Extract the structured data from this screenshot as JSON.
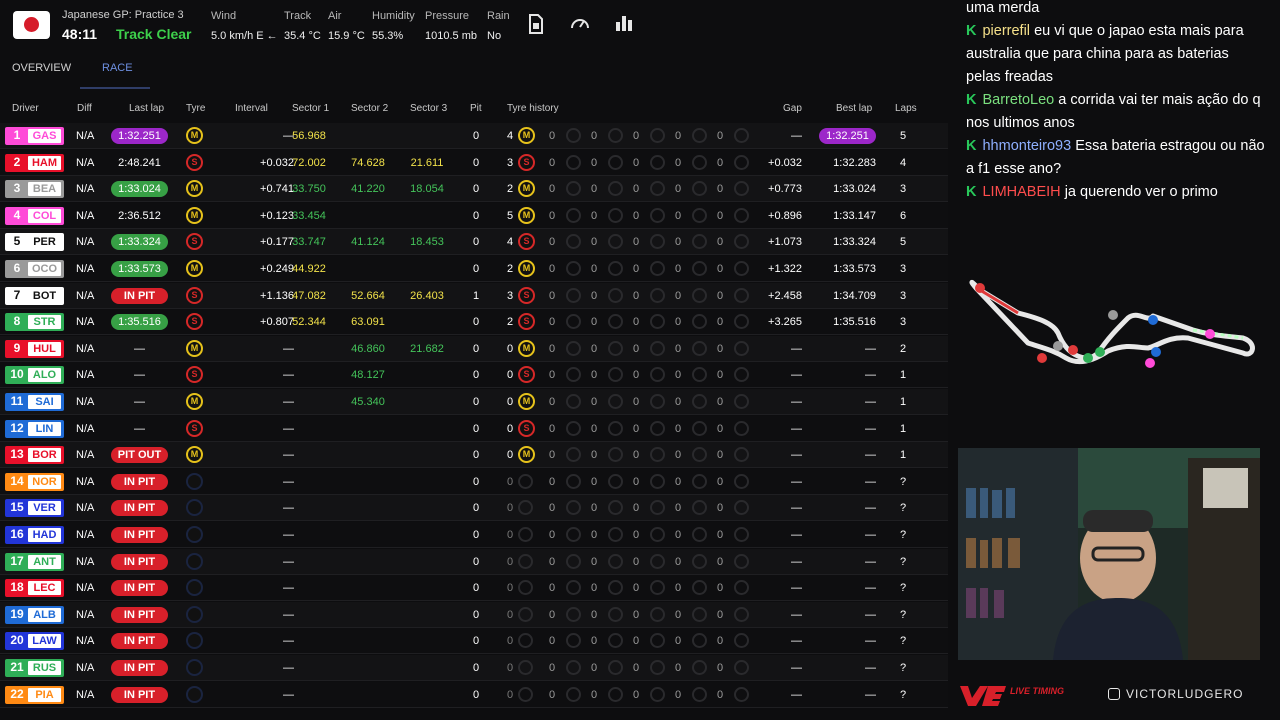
{
  "header": {
    "session_name": "Japanese GP: Practice 3",
    "session_time": "48:11",
    "track_status": "Track Clear",
    "weather": [
      {
        "label": "Wind",
        "value": "5.0 km/h E ←"
      },
      {
        "label": "Track",
        "value": "35.4 °C"
      },
      {
        "label": "Air",
        "value": "15.9 °C"
      },
      {
        "label": "Humidity",
        "value": "55.3%"
      },
      {
        "label": "Pressure",
        "value": "1010.5 mb"
      },
      {
        "label": "Rain",
        "value": "No"
      }
    ]
  },
  "tabs": [
    {
      "label": "OVERVIEW",
      "active": false
    },
    {
      "label": "RACE",
      "active": true
    }
  ],
  "columns": [
    "Driver",
    "Diff",
    "Last lap",
    "Tyre",
    "Interval",
    "Sector 1",
    "Sector 2",
    "Sector 3",
    "Pit",
    "Tyre history",
    "Gap",
    "Best lap",
    "Laps"
  ],
  "rows": [
    {
      "pos": "1",
      "driver": "GAS",
      "team_color": "#ff4bd8",
      "diff": "N/A",
      "last_lap": "1:32.251",
      "last_style": "purple",
      "tyre": "M",
      "interval": "—",
      "s1": "56.968",
      "s1_style": "yellow",
      "s2": "",
      "s3": "",
      "pit": "0",
      "stint": "4",
      "stint_tyre": "M",
      "gap": "—",
      "best": "1:32.251",
      "best_style": "purple",
      "laps": "5"
    },
    {
      "pos": "2",
      "driver": "HAM",
      "team_color": "#e8102a",
      "diff": "N/A",
      "last_lap": "2:48.241",
      "last_style": "",
      "tyre": "S",
      "interval": "+0.032",
      "s1": "72.002",
      "s1_style": "yellow",
      "s2": "74.628",
      "s2_style": "yellow",
      "s3": "21.611",
      "s3_style": "yellow",
      "pit": "0",
      "stint": "3",
      "stint_tyre": "S",
      "gap": "+0.032",
      "best": "1:32.283",
      "best_style": "",
      "laps": "4"
    },
    {
      "pos": "3",
      "driver": "BEA",
      "team_color": "#9a9a9a",
      "diff": "N/A",
      "last_lap": "1:33.024",
      "last_style": "green",
      "tyre": "M",
      "interval": "+0.741",
      "s1": "33.750",
      "s1_style": "green",
      "s2": "41.220",
      "s2_style": "green",
      "s3": "18.054",
      "s3_style": "green",
      "pit": "0",
      "stint": "2",
      "stint_tyre": "M",
      "gap": "+0.773",
      "best": "1:33.024",
      "best_style": "",
      "laps": "3"
    },
    {
      "pos": "4",
      "driver": "COL",
      "team_color": "#ff4bd8",
      "diff": "N/A",
      "last_lap": "2:36.512",
      "last_style": "",
      "tyre": "M",
      "interval": "+0.123",
      "s1": "33.454",
      "s1_style": "green",
      "s2": "",
      "s3": "",
      "pit": "0",
      "stint": "5",
      "stint_tyre": "M",
      "gap": "+0.896",
      "best": "1:33.147",
      "best_style": "",
      "laps": "6"
    },
    {
      "pos": "5",
      "driver": "PER",
      "team_color": "#ffffff",
      "diff": "N/A",
      "last_lap": "1:33.324",
      "last_style": "green",
      "tyre": "S",
      "interval": "+0.177",
      "s1": "33.747",
      "s1_style": "green",
      "s2": "41.124",
      "s2_style": "green",
      "s3": "18.453",
      "s3_style": "green",
      "pit": "0",
      "stint": "4",
      "stint_tyre": "S",
      "gap": "+1.073",
      "best": "1:33.324",
      "best_style": "",
      "laps": "5"
    },
    {
      "pos": "6",
      "driver": "OCO",
      "team_color": "#9a9a9a",
      "diff": "N/A",
      "last_lap": "1:33.573",
      "last_style": "green",
      "tyre": "M",
      "interval": "+0.249",
      "s1": "44.922",
      "s1_style": "yellow",
      "s2": "",
      "s3": "",
      "pit": "0",
      "stint": "2",
      "stint_tyre": "M",
      "gap": "+1.322",
      "best": "1:33.573",
      "best_style": "",
      "laps": "3"
    },
    {
      "pos": "7",
      "driver": "BOT",
      "team_color": "#ffffff",
      "diff": "N/A",
      "last_lap": "IN PIT",
      "last_style": "red",
      "tyre": "S",
      "interval": "+1.136",
      "s1": "47.082",
      "s1_style": "yellow",
      "s2": "52.664",
      "s2_style": "yellow",
      "s3": "26.403",
      "s3_style": "yellow",
      "pit": "1",
      "stint": "3",
      "stint_tyre": "S",
      "gap": "+2.458",
      "best": "1:34.709",
      "best_style": "",
      "laps": "3"
    },
    {
      "pos": "8",
      "driver": "STR",
      "team_color": "#2fae57",
      "diff": "N/A",
      "last_lap": "1:35.516",
      "last_style": "green",
      "tyre": "S",
      "interval": "+0.807",
      "s1": "52.344",
      "s1_style": "yellow",
      "s2": "63.091",
      "s2_style": "yellow",
      "s3": "",
      "pit": "0",
      "stint": "2",
      "stint_tyre": "S",
      "gap": "+3.265",
      "best": "1:35.516",
      "best_style": "",
      "laps": "3"
    },
    {
      "pos": "9",
      "driver": "HUL",
      "team_color": "#e8102a",
      "diff": "N/A",
      "last_lap": "—",
      "last_style": "",
      "tyre": "M",
      "interval": "—",
      "s1": "",
      "s2": "46.860",
      "s2_style": "green",
      "s3": "21.682",
      "s3_style": "green",
      "pit": "0",
      "stint": "0",
      "stint_tyre": "M",
      "gap": "—",
      "best": "—",
      "best_style": "",
      "laps": "2"
    },
    {
      "pos": "10",
      "driver": "ALO",
      "team_color": "#2fae57",
      "diff": "N/A",
      "last_lap": "—",
      "last_style": "",
      "tyre": "S",
      "interval": "—",
      "s1": "",
      "s2": "48.127",
      "s2_style": "green",
      "s3": "",
      "pit": "0",
      "stint": "0",
      "stint_tyre": "S",
      "gap": "—",
      "best": "—",
      "best_style": "",
      "laps": "1"
    },
    {
      "pos": "11",
      "driver": "SAI",
      "team_color": "#1f6bd6",
      "diff": "N/A",
      "last_lap": "—",
      "last_style": "",
      "tyre": "M",
      "interval": "—",
      "s1": "",
      "s2": "45.340",
      "s2_style": "green",
      "s3": "",
      "pit": "0",
      "stint": "0",
      "stint_tyre": "M",
      "gap": "—",
      "best": "—",
      "best_style": "",
      "laps": "1"
    },
    {
      "pos": "12",
      "driver": "LIN",
      "team_color": "#1f6bd6",
      "diff": "N/A",
      "last_lap": "—",
      "last_style": "",
      "tyre": "S",
      "interval": "—",
      "s1": "",
      "s2": "",
      "s3": "",
      "pit": "0",
      "stint": "0",
      "stint_tyre": "S",
      "gap": "—",
      "best": "—",
      "best_style": "",
      "laps": "1"
    },
    {
      "pos": "13",
      "driver": "BOR",
      "team_color": "#e8102a",
      "diff": "N/A",
      "last_lap": "PIT OUT",
      "last_style": "red",
      "tyre": "M",
      "interval": "—",
      "s1": "",
      "s2": "",
      "s3": "",
      "pit": "0",
      "stint": "0",
      "stint_tyre": "M",
      "gap": "—",
      "best": "—",
      "best_style": "",
      "laps": "1"
    },
    {
      "pos": "14",
      "driver": "NOR",
      "team_color": "#ff8a14",
      "diff": "N/A",
      "last_lap": "IN PIT",
      "last_style": "red",
      "tyre": "N",
      "interval": "—",
      "s1": "",
      "s2": "",
      "s3": "",
      "pit": "0",
      "stint": "0",
      "stint_tyre": "",
      "gap": "—",
      "best": "—",
      "best_style": "",
      "laps": "?"
    },
    {
      "pos": "15",
      "driver": "VER",
      "team_color": "#2235d8",
      "diff": "N/A",
      "last_lap": "IN PIT",
      "last_style": "red",
      "tyre": "N",
      "interval": "—",
      "s1": "",
      "s2": "",
      "s3": "",
      "pit": "0",
      "stint": "0",
      "stint_tyre": "",
      "gap": "—",
      "best": "—",
      "best_style": "",
      "laps": "?"
    },
    {
      "pos": "16",
      "driver": "HAD",
      "team_color": "#2235d8",
      "diff": "N/A",
      "last_lap": "IN PIT",
      "last_style": "red",
      "tyre": "N",
      "interval": "—",
      "s1": "",
      "s2": "",
      "s3": "",
      "pit": "0",
      "stint": "0",
      "stint_tyre": "",
      "gap": "—",
      "best": "—",
      "best_style": "",
      "laps": "?"
    },
    {
      "pos": "17",
      "driver": "ANT",
      "team_color": "#2fae57",
      "diff": "N/A",
      "last_lap": "IN PIT",
      "last_style": "red",
      "tyre": "N",
      "interval": "—",
      "s1": "",
      "s2": "",
      "s3": "",
      "pit": "0",
      "stint": "0",
      "stint_tyre": "",
      "gap": "—",
      "best": "—",
      "best_style": "",
      "laps": "?"
    },
    {
      "pos": "18",
      "driver": "LEC",
      "team_color": "#e8102a",
      "diff": "N/A",
      "last_lap": "IN PIT",
      "last_style": "red",
      "tyre": "N",
      "interval": "—",
      "s1": "",
      "s2": "",
      "s3": "",
      "pit": "0",
      "stint": "0",
      "stint_tyre": "",
      "gap": "—",
      "best": "—",
      "best_style": "",
      "laps": "?"
    },
    {
      "pos": "19",
      "driver": "ALB",
      "team_color": "#1f6bd6",
      "diff": "N/A",
      "last_lap": "IN PIT",
      "last_style": "red",
      "tyre": "N",
      "interval": "—",
      "s1": "",
      "s2": "",
      "s3": "",
      "pit": "0",
      "stint": "0",
      "stint_tyre": "",
      "gap": "—",
      "best": "—",
      "best_style": "",
      "laps": "?"
    },
    {
      "pos": "20",
      "driver": "LAW",
      "team_color": "#2235d8",
      "diff": "N/A",
      "last_lap": "IN PIT",
      "last_style": "red",
      "tyre": "N",
      "interval": "—",
      "s1": "",
      "s2": "",
      "s3": "",
      "pit": "0",
      "stint": "0",
      "stint_tyre": "",
      "gap": "—",
      "best": "—",
      "best_style": "",
      "laps": "?"
    },
    {
      "pos": "21",
      "driver": "RUS",
      "team_color": "#2fae57",
      "diff": "N/A",
      "last_lap": "IN PIT",
      "last_style": "red",
      "tyre": "N",
      "interval": "—",
      "s1": "",
      "s2": "",
      "s3": "",
      "pit": "0",
      "stint": "0",
      "stint_tyre": "",
      "gap": "—",
      "best": "—",
      "best_style": "",
      "laps": "?"
    },
    {
      "pos": "22",
      "driver": "PIA",
      "team_color": "#ff8a14",
      "diff": "N/A",
      "last_lap": "IN PIT",
      "last_style": "red",
      "tyre": "N",
      "interval": "—",
      "s1": "",
      "s2": "",
      "s3": "",
      "pit": "0",
      "stint": "0",
      "stint_tyre": "",
      "gap": "—",
      "best": "—",
      "best_style": "",
      "laps": "?"
    }
  ],
  "history_zeros": [
    "0",
    "0",
    "0",
    "0",
    "0"
  ],
  "chat": [
    {
      "user": "",
      "message": "uma merda",
      "color": "#ffffff"
    },
    {
      "user": "pierrefil",
      "message": "eu vi que o japao esta mais para australia que para china para as baterias pelas freadas",
      "color": "#f5e08a"
    },
    {
      "user": "BarretoLeo",
      "message": "a corrida vai ter mais ação do q nos ultimos anos",
      "color": "#7be07f"
    },
    {
      "user": "hhmonteiro93",
      "message": "Essa bateria estragou ou não a f1 esse ano?",
      "color": "#8fb0ff"
    },
    {
      "user": "LIMHABEIH",
      "message": "ja querendo ver o primo",
      "color": "#ff4d4d"
    }
  ],
  "footer": {
    "logo_text": "LIVE TIMING",
    "social": "VICTORLUDGERO"
  },
  "icons": [
    "japan-flag-icon",
    "document-icon",
    "speedometer-icon",
    "bar-chart-icon",
    "chat-badge-icon",
    "instagram-icon"
  ]
}
